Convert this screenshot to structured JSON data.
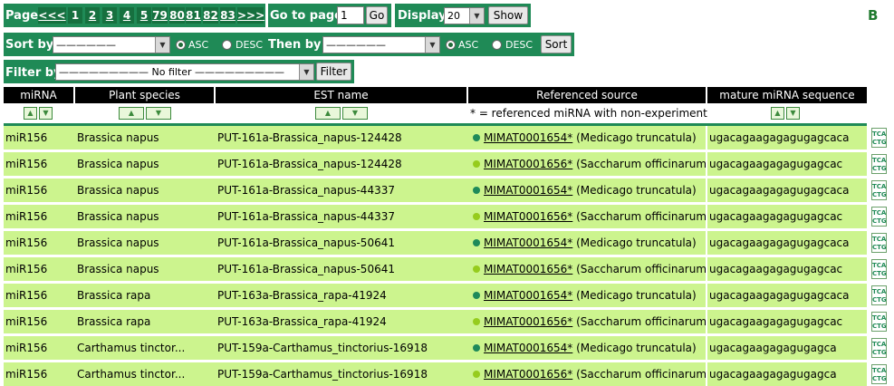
{
  "panel_label": "B",
  "pagination": {
    "label": "Page",
    "first": "<<<",
    "pages": [
      "1",
      "2",
      "3",
      "4",
      "5",
      "79",
      "80",
      "81",
      "82",
      "83"
    ],
    "current": "1",
    "last": ">>>",
    "goto_label": "Go to page",
    "goto_value": "1",
    "go_button": "Go",
    "display_label": "Display",
    "display_value": "20",
    "show_button": "Show"
  },
  "sort": {
    "label": "Sort by",
    "select1": "——————",
    "asc": "ASC",
    "desc": "DESC",
    "then_label": "Then by",
    "select2": "——————",
    "asc2": "ASC",
    "desc2": "DESC",
    "button": "Sort"
  },
  "filter": {
    "label": "Filter by",
    "select": "————————— No filter —————————",
    "button": "Filter"
  },
  "table": {
    "headers": [
      "miRNA",
      "Plant species",
      "EST name",
      "Referenced source",
      "mature miRNA sequence"
    ],
    "note": "* = referenced miRNA with non-experiment",
    "dot_colors": {
      "teal": "#1e8a5a",
      "lime": "#96cc1e"
    },
    "rows": [
      {
        "mirna": "miR156",
        "species": "Brassica napus",
        "est": "PUT-161a-Brassica_napus-124428",
        "ref_id": "MIMAT0001654*",
        "ref_org": "(Medicago truncatula)",
        "dot": "teal",
        "seq": "ugacagaagagagugagcaca"
      },
      {
        "mirna": "miR156",
        "species": "Brassica napus",
        "est": "PUT-161a-Brassica_napus-124428",
        "ref_id": "MIMAT0001656*",
        "ref_org": "(Saccharum officinarum)",
        "dot": "lime",
        "seq": "ugacagaagagagugagcac"
      },
      {
        "mirna": "miR156",
        "species": "Brassica napus",
        "est": "PUT-161a-Brassica_napus-44337",
        "ref_id": "MIMAT0001654*",
        "ref_org": "(Medicago truncatula)",
        "dot": "teal",
        "seq": "ugacagaagagagugagcaca"
      },
      {
        "mirna": "miR156",
        "species": "Brassica napus",
        "est": "PUT-161a-Brassica_napus-44337",
        "ref_id": "MIMAT0001656*",
        "ref_org": "(Saccharum officinarum)",
        "dot": "lime",
        "seq": "ugacagaagagagugagcac"
      },
      {
        "mirna": "miR156",
        "species": "Brassica napus",
        "est": "PUT-161a-Brassica_napus-50641",
        "ref_id": "MIMAT0001654*",
        "ref_org": "(Medicago truncatula)",
        "dot": "teal",
        "seq": "ugacagaagagagugagcaca"
      },
      {
        "mirna": "miR156",
        "species": "Brassica napus",
        "est": "PUT-161a-Brassica_napus-50641",
        "ref_id": "MIMAT0001656*",
        "ref_org": "(Saccharum officinarum)",
        "dot": "lime",
        "seq": "ugacagaagagagugagcac"
      },
      {
        "mirna": "miR156",
        "species": "Brassica rapa",
        "est": "PUT-163a-Brassica_rapa-41924",
        "ref_id": "MIMAT0001654*",
        "ref_org": "(Medicago truncatula)",
        "dot": "teal",
        "seq": "ugacagaagagagugagcaca"
      },
      {
        "mirna": "miR156",
        "species": "Brassica rapa",
        "est": "PUT-163a-Brassica_rapa-41924",
        "ref_id": "MIMAT0001656*",
        "ref_org": "(Saccharum officinarum)",
        "dot": "lime",
        "seq": "ugacagaagagagugagcac"
      },
      {
        "mirna": "miR156",
        "species": "Carthamus tinctor...",
        "est": "PUT-159a-Carthamus_tinctorius-16918",
        "ref_id": "MIMAT0001654*",
        "ref_org": "(Medicago truncatula)",
        "dot": "teal",
        "seq": "ugacagaagagagugagca"
      },
      {
        "mirna": "miR156",
        "species": "Carthamus tinctor...",
        "est": "PUT-159a-Carthamus_tinctorius-16918",
        "ref_id": "MIMAT0001656*",
        "ref_org": "(Saccharum officinarum)",
        "dot": "lime",
        "seq": "ugacagaagagagugagca"
      }
    ],
    "tca_icon_text": [
      "TCA",
      "CTG"
    ]
  }
}
